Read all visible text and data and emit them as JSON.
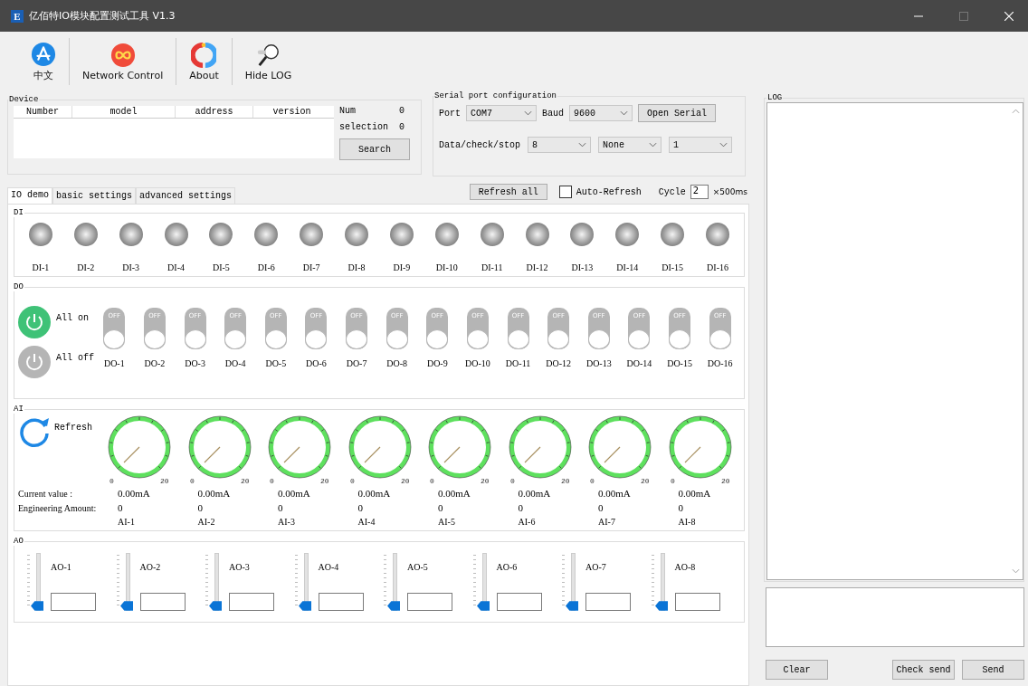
{
  "window": {
    "icon_text": "E",
    "title": "亿佰特IO模块配置测试工具 V1.3"
  },
  "toolbar": [
    {
      "kind": "language",
      "label": "中文"
    },
    {
      "kind": "network",
      "label": "Network Control"
    },
    {
      "kind": "about",
      "label": "About"
    },
    {
      "kind": "log",
      "label": "Hide LOG"
    }
  ],
  "device": {
    "title": "Device",
    "columns": [
      "Number",
      "model",
      "address",
      "version"
    ],
    "num_label": "Num",
    "num_value": "0",
    "selection_label": "selection",
    "selection_value": "0",
    "search_button": "Search"
  },
  "serial": {
    "title": "Serial port configuration",
    "port_label": "Port",
    "port": "COM7",
    "baud_label": "Baud",
    "baud": "9600",
    "open_button": "Open Serial",
    "frame_label": "Data/check/stop",
    "data_bits": "8",
    "check": "None",
    "stop_bits": "1"
  },
  "tabs": [
    {
      "label": "IO demo",
      "selected": true
    },
    {
      "label": "basic settings",
      "selected": false
    },
    {
      "label": "advanced settings",
      "selected": false
    }
  ],
  "refresh_all": "Refresh all",
  "auto_refresh": {
    "label": "Auto-Refresh",
    "checked": false
  },
  "cycle": {
    "label": "Cycle",
    "value": "2",
    "unit": "×500ms"
  },
  "di": {
    "title": "DI",
    "items": [
      {
        "label": "DI-1",
        "on": false
      },
      {
        "label": "DI-2",
        "on": false
      },
      {
        "label": "DI-3",
        "on": false
      },
      {
        "label": "DI-4",
        "on": false
      },
      {
        "label": "DI-5",
        "on": false
      },
      {
        "label": "DI-6",
        "on": false
      },
      {
        "label": "DI-7",
        "on": false
      },
      {
        "label": "DI-8",
        "on": false
      },
      {
        "label": "DI-9",
        "on": false
      },
      {
        "label": "DI-10",
        "on": false
      },
      {
        "label": "DI-11",
        "on": false
      },
      {
        "label": "DI-12",
        "on": false
      },
      {
        "label": "DI-13",
        "on": false
      },
      {
        "label": "DI-14",
        "on": false
      },
      {
        "label": "DI-15",
        "on": false
      },
      {
        "label": "DI-16",
        "on": false
      }
    ]
  },
  "do": {
    "title": "DO",
    "all_on": "All on",
    "all_off": "All off",
    "items": [
      {
        "label": "DO-1",
        "state_text": "OFF",
        "on": false
      },
      {
        "label": "DO-2",
        "state_text": "OFF",
        "on": false
      },
      {
        "label": "DO-3",
        "state_text": "OFF",
        "on": false
      },
      {
        "label": "DO-4",
        "state_text": "OFF",
        "on": false
      },
      {
        "label": "DO-5",
        "state_text": "OFF",
        "on": false
      },
      {
        "label": "DO-6",
        "state_text": "OFF",
        "on": false
      },
      {
        "label": "DO-7",
        "state_text": "OFF",
        "on": false
      },
      {
        "label": "DO-8",
        "state_text": "OFF",
        "on": false
      },
      {
        "label": "DO-9",
        "state_text": "OFF",
        "on": false
      },
      {
        "label": "DO-10",
        "state_text": "OFF",
        "on": false
      },
      {
        "label": "DO-11",
        "state_text": "OFF",
        "on": false
      },
      {
        "label": "DO-12",
        "state_text": "OFF",
        "on": false
      },
      {
        "label": "DO-13",
        "state_text": "OFF",
        "on": false
      },
      {
        "label": "DO-14",
        "state_text": "OFF",
        "on": false
      },
      {
        "label": "DO-15",
        "state_text": "OFF",
        "on": false
      },
      {
        "label": "DO-16",
        "state_text": "OFF",
        "on": false
      }
    ]
  },
  "ai": {
    "title": "AI",
    "refresh": "Refresh",
    "current_label": "Current value :",
    "engineering_label": "Engineering Amount:",
    "items": [
      {
        "label": "AI-1",
        "min": "0",
        "max": "20",
        "current": "0.00mA",
        "engineering": "0"
      },
      {
        "label": "AI-2",
        "min": "0",
        "max": "20",
        "current": "0.00mA",
        "engineering": "0"
      },
      {
        "label": "AI-3",
        "min": "0",
        "max": "20",
        "current": "0.00mA",
        "engineering": "0"
      },
      {
        "label": "AI-4",
        "min": "0",
        "max": "20",
        "current": "0.00mA",
        "engineering": "0"
      },
      {
        "label": "AI-5",
        "min": "0",
        "max": "20",
        "current": "0.00mA",
        "engineering": "0"
      },
      {
        "label": "AI-6",
        "min": "0",
        "max": "20",
        "current": "0.00mA",
        "engineering": "0"
      },
      {
        "label": "AI-7",
        "min": "0",
        "max": "20",
        "current": "0.00mA",
        "engineering": "0"
      },
      {
        "label": "AI-8",
        "min": "0",
        "max": "20",
        "current": "0.00mA",
        "engineering": "0"
      }
    ]
  },
  "ao": {
    "title": "AO",
    "items": [
      {
        "label": "AO-1",
        "level": 0
      },
      {
        "label": "AO-2",
        "level": 0
      },
      {
        "label": "AO-3",
        "level": 0
      },
      {
        "label": "AO-4",
        "level": 0
      },
      {
        "label": "AO-5",
        "level": 0
      },
      {
        "label": "AO-6",
        "level": 0
      },
      {
        "label": "AO-7",
        "level": 0
      },
      {
        "label": "AO-8",
        "level": 0
      }
    ]
  },
  "log": {
    "title": "LOG",
    "clear_button": "Clear",
    "check_send_button": "Check send",
    "send_button": "Send"
  }
}
